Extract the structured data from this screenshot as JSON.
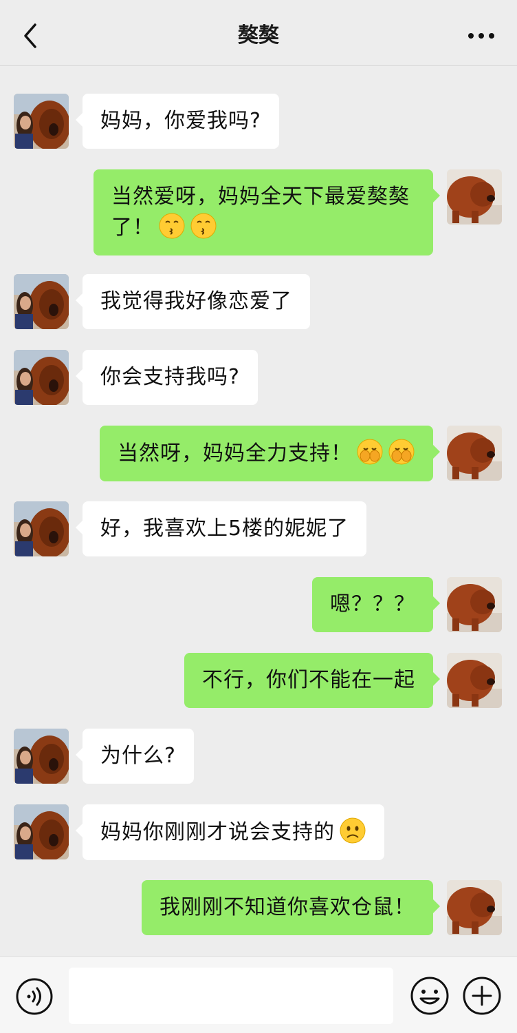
{
  "header": {
    "title": "獒獒",
    "back_icon": "chevron-left-icon",
    "more_icon": "ellipsis-icon"
  },
  "colors": {
    "background": "#ededed",
    "sent_bubble": "#95ec69",
    "received_bubble": "#ffffff"
  },
  "messages": [
    {
      "side": "left",
      "text": "妈妈，你爱我吗?",
      "emojis": []
    },
    {
      "side": "right",
      "text": "当然爱呀，妈妈全天下最爱獒獒了！",
      "emojis": [
        "kissing-face-icon",
        "kissing-face-icon"
      ]
    },
    {
      "side": "left",
      "text": "我觉得我好像恋爱了",
      "emojis": []
    },
    {
      "side": "left",
      "text": "你会支持我吗?",
      "emojis": []
    },
    {
      "side": "right",
      "text": "当然呀，妈妈全力支持！",
      "emojis": [
        "face-with-hand-over-mouth-icon",
        "face-with-hand-over-mouth-icon"
      ]
    },
    {
      "side": "left",
      "text": "好，我喜欢上5楼的妮妮了",
      "emojis": []
    },
    {
      "side": "right",
      "text": "嗯？？？",
      "emojis": []
    },
    {
      "side": "right",
      "text": "不行，你们不能在一起",
      "emojis": []
    },
    {
      "side": "left",
      "text": "为什么?",
      "emojis": []
    },
    {
      "side": "left",
      "text": "妈妈你刚刚才说会支持的",
      "emojis": [
        "frowning-face-icon"
      ]
    },
    {
      "side": "right",
      "text": "我刚刚不知道你喜欢仓鼠！",
      "emojis": []
    }
  ],
  "input_bar": {
    "voice_icon": "voice-icon",
    "emoji_icon": "smiley-icon",
    "plus_icon": "plus-circle-icon",
    "placeholder": ""
  }
}
